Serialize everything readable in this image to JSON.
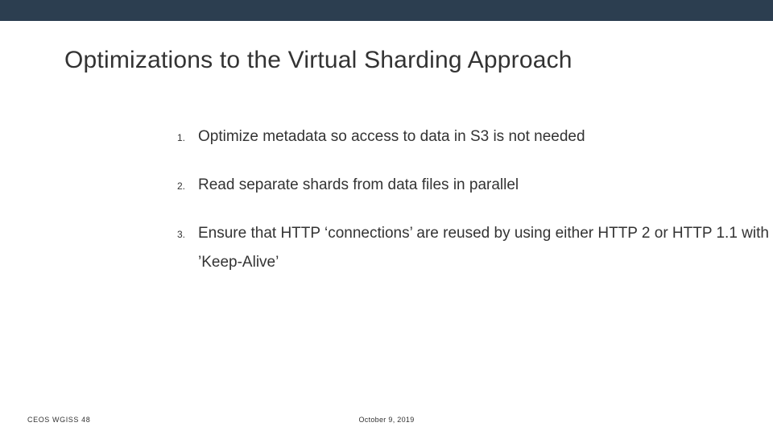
{
  "slide": {
    "title": "Optimizations to the Virtual Sharding Approach",
    "items": [
      {
        "num": "1.",
        "text": "Optimize metadata so access to data in S3 is not needed"
      },
      {
        "num": "2.",
        "text": "Read separate shards from data files in parallel"
      },
      {
        "num": "3.",
        "text": "Ensure that HTTP ‘connections’ are reused by using either HTTP 2 or HTTP 1.1 with ’Keep-Alive’"
      }
    ]
  },
  "footer": {
    "left": "CEOS WGISS 48",
    "center": "October 9, 2019"
  }
}
